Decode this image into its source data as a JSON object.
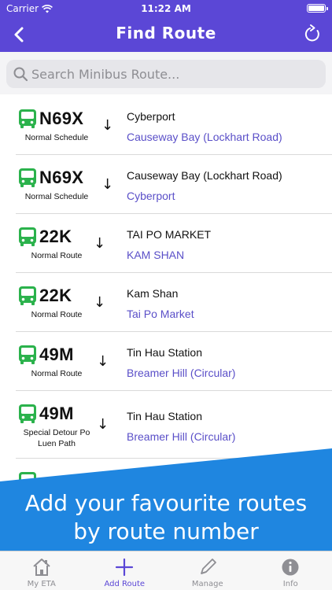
{
  "status_bar": {
    "carrier": "Carrier",
    "time": "11:22 AM"
  },
  "nav": {
    "title": "Find Route"
  },
  "search": {
    "placeholder": "Search Minibus Route..."
  },
  "routes": [
    {
      "number": "N69X",
      "schedule": "Normal Schedule",
      "from": "Cyberport",
      "to": "Causeway Bay (Lockhart Road)"
    },
    {
      "number": "N69X",
      "schedule": "Normal Schedule",
      "from": "Causeway Bay (Lockhart Road)",
      "to": "Cyberport"
    },
    {
      "number": "22K",
      "schedule": "Normal Route",
      "from": "TAI PO MARKET",
      "to": "KAM SHAN"
    },
    {
      "number": "22K",
      "schedule": "Normal Route",
      "from": "Kam Shan",
      "to": "Tai Po Market"
    },
    {
      "number": "49M",
      "schedule": "Normal Route",
      "from": "Tin Hau Station",
      "to": "Breamer Hill (Circular)"
    },
    {
      "number": "49M",
      "schedule": "Special Detour Po Luen Path",
      "from": "Tin Hau Station",
      "to": "Breamer Hill (Circular)"
    }
  ],
  "banner": {
    "line1": "Add your favourite routes",
    "line2": "by route number"
  },
  "tabs": [
    {
      "label": "My ETA",
      "icon": "home-icon"
    },
    {
      "label": "Add Route",
      "icon": "plus-icon"
    },
    {
      "label": "Manage",
      "icon": "pencil-icon"
    },
    {
      "label": "Info",
      "icon": "info-icon"
    }
  ],
  "colors": {
    "header": "#5b47d6",
    "banner": "#1f86e0",
    "bus_icon": "#2bb24c",
    "destination_text": "#5a4fc8"
  }
}
